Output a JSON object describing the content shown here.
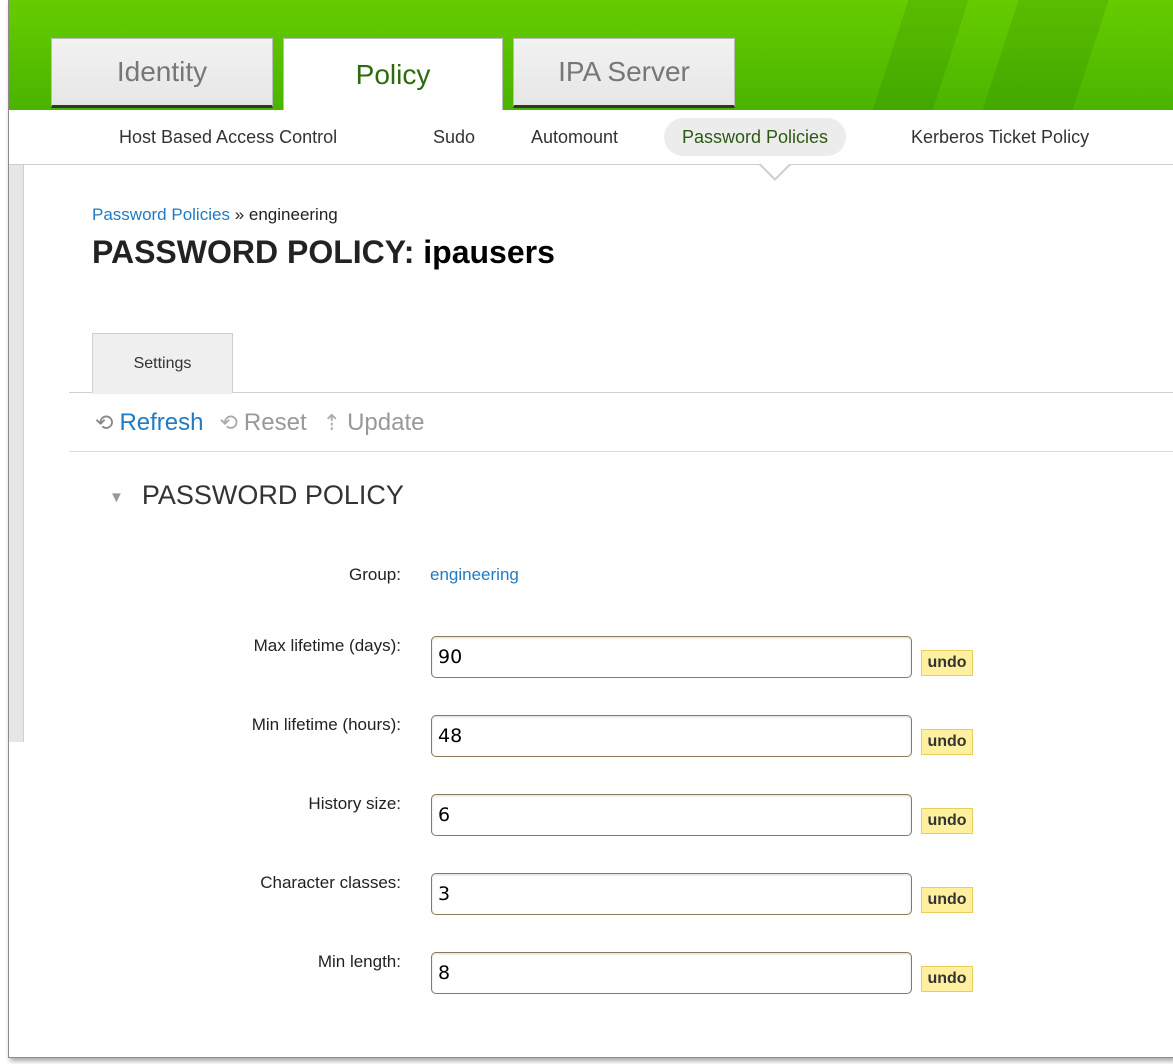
{
  "nav": {
    "tabs": [
      {
        "label": "Identity"
      },
      {
        "label": "Policy"
      },
      {
        "label": "IPA Server"
      }
    ],
    "subtabs": [
      {
        "label": "Host Based Access Control"
      },
      {
        "label": "Sudo"
      },
      {
        "label": "Automount"
      },
      {
        "label": "Password Policies"
      },
      {
        "label": "Kerberos Ticket Policy"
      }
    ]
  },
  "breadcrumb": {
    "link": "Password Policies",
    "separator": "»",
    "current": "engineering"
  },
  "title": {
    "prefix": "PASSWORD POLICY:",
    "value": "ipausers"
  },
  "facet_tab": "Settings",
  "actions": {
    "refresh": "Refresh",
    "reset": "Reset",
    "update": "Update"
  },
  "section": {
    "title": "PASSWORD POLICY",
    "group_label": "Group:",
    "group_value": "engineering",
    "undo_label": "undo",
    "fields": [
      {
        "label": "Max lifetime (days):",
        "value": "90"
      },
      {
        "label": "Min lifetime (hours):",
        "value": "48"
      },
      {
        "label": "History size:",
        "value": "6"
      },
      {
        "label": "Character classes:",
        "value": "3"
      },
      {
        "label": "Min length:",
        "value": "8"
      }
    ]
  },
  "colors": {
    "header_green": "#5cc000",
    "active_tab_text": "#2d6b0e",
    "link_blue": "#1f7bc4",
    "undo_bg": "#fff0a0"
  }
}
